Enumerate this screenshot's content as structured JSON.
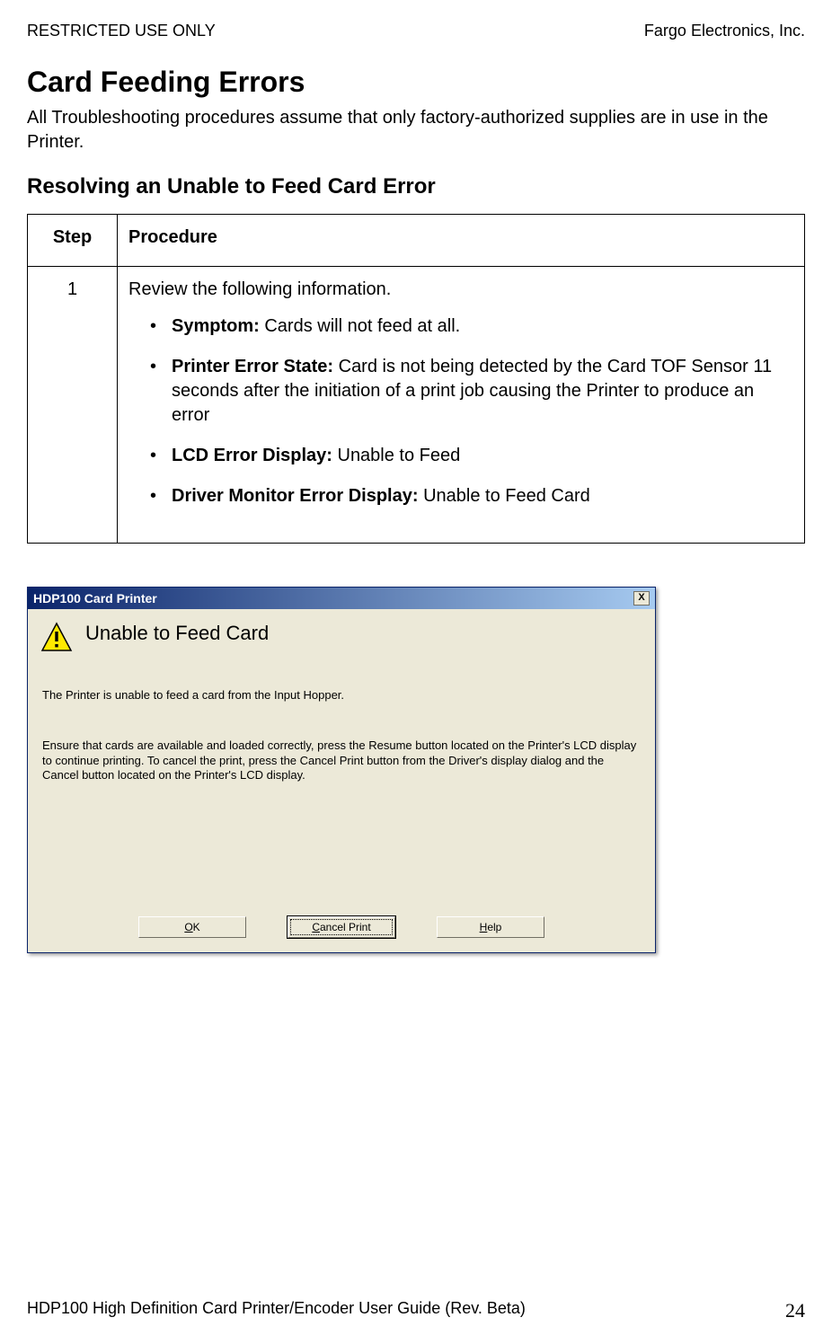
{
  "header": {
    "left": "RESTRICTED USE ONLY",
    "right": "Fargo Electronics, Inc."
  },
  "title": "Card Feeding Errors",
  "intro": "All Troubleshooting procedures assume that only factory-authorized supplies are in use in the Printer.",
  "subheading": "Resolving an Unable to Feed Card Error",
  "table": {
    "head_step": "Step",
    "head_procedure": "Procedure",
    "step_num": "1",
    "review_line": "Review the following information.",
    "symptom_label": "Symptom:",
    "symptom_text": " Cards will not feed at all.",
    "pes_label": "Printer Error State:",
    "pes_text": " Card is not being detected by the Card TOF Sensor 11 seconds after the initiation of a print job causing the Printer to produce an error",
    "lcd_label": "LCD Error Display:",
    "lcd_text": " Unable to Feed",
    "drv_label": "Driver Monitor Error Display:",
    "drv_text": " Unable to Feed Card"
  },
  "dialog": {
    "title": "HDP100 Card Printer",
    "close": "X",
    "error_title": "Unable to Feed Card",
    "body1": "The Printer is unable to feed a card from the Input Hopper.",
    "body2": "Ensure that cards are available and loaded correctly, press the Resume button located on the Printer's LCD display to continue printing. To cancel the print, press the Cancel Print button from the Driver's display dialog and the Cancel button located on the Printer's LCD display.",
    "btn_ok": "OK",
    "btn_cancel": "Cancel Print",
    "btn_help": "Help"
  },
  "footer": {
    "left": "HDP100 High Definition Card Printer/Encoder User Guide (Rev. Beta)",
    "page": "24"
  }
}
